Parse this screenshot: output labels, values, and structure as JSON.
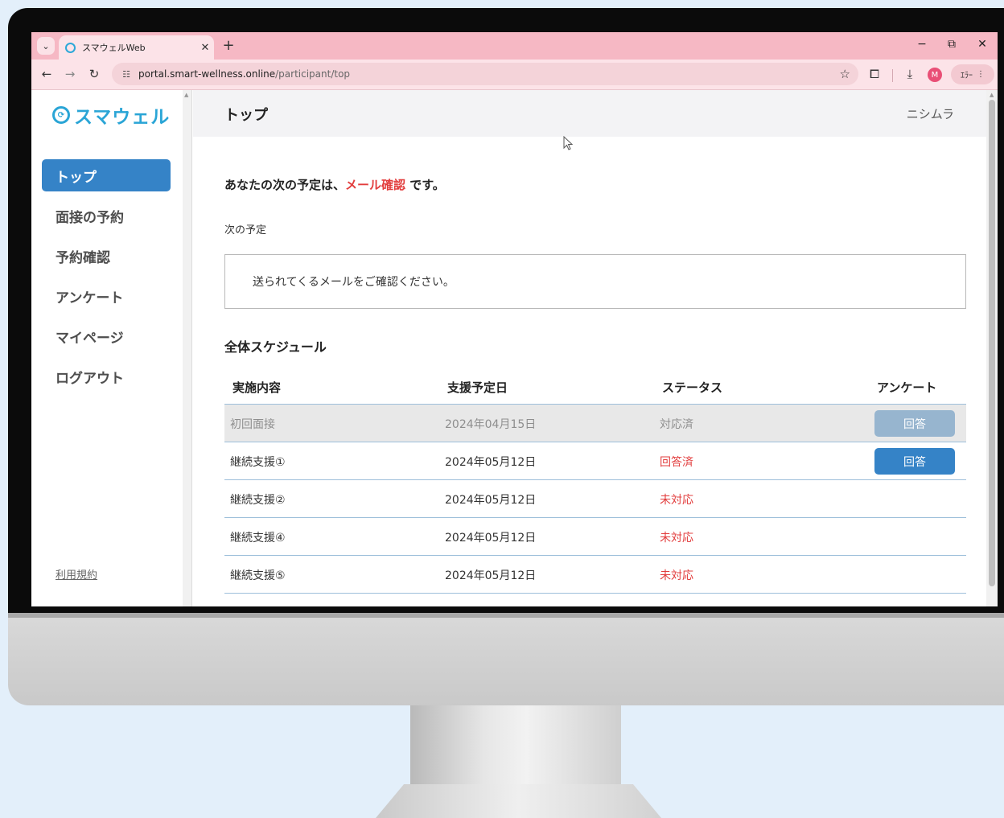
{
  "browser": {
    "tab_title": "スマウェルWeb",
    "url_host": "portal.smart-wellness.online",
    "url_path": "/participant/top",
    "profile_initial": "M",
    "error_chip": "ｴﾗｰ"
  },
  "sidebar": {
    "logo_text": "スマウェル",
    "items": [
      {
        "label": "トップ",
        "active": true
      },
      {
        "label": "面接の予約",
        "active": false
      },
      {
        "label": "予約確認",
        "active": false
      },
      {
        "label": "アンケート",
        "active": false
      },
      {
        "label": "マイページ",
        "active": false
      },
      {
        "label": "ログアウト",
        "active": false
      }
    ],
    "terms_link": "利用規約"
  },
  "header": {
    "title": "トップ",
    "user_name": "ニシムラ"
  },
  "next_schedule": {
    "message_prefix": "あなたの次の予定は、",
    "message_highlight": "メール確認",
    "message_suffix": " です。",
    "label": "次の予定",
    "content": "送られてくるメールをご確認ください。"
  },
  "schedule": {
    "title": "全体スケジュール",
    "columns": [
      "実施内容",
      "支援予定日",
      "ステータス",
      "アンケート"
    ],
    "rows": [
      {
        "item": "初回面接",
        "date": "2024年04月15日",
        "status": "対応済",
        "survey_button": "回答",
        "done": true
      },
      {
        "item": "継続支援①",
        "date": "2024年05月12日",
        "status": "回答済",
        "survey_button": "回答",
        "done": false
      },
      {
        "item": "継続支援②",
        "date": "2024年05月12日",
        "status": "未対応",
        "survey_button": "",
        "done": false
      },
      {
        "item": "継続支援④",
        "date": "2024年05月12日",
        "status": "未対応",
        "survey_button": "",
        "done": false
      },
      {
        "item": "継続支援⑤",
        "date": "2024年05月12日",
        "status": "未対応",
        "survey_button": "",
        "done": false
      }
    ]
  },
  "colors": {
    "accent": "#3583c7",
    "brand": "#2aa5d6",
    "alert": "#e23d3d",
    "browser_frame": "#f6b8c4"
  }
}
